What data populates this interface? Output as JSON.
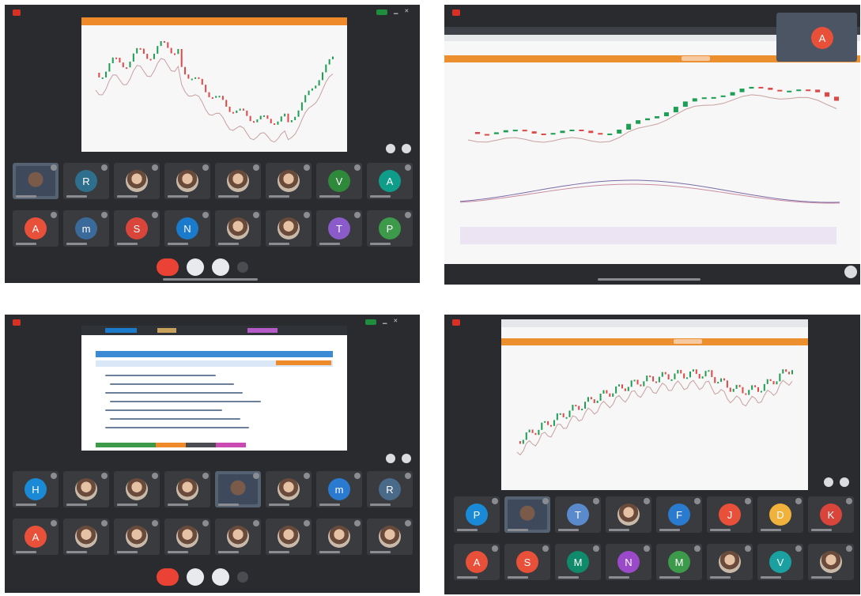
{
  "colors": {
    "panel_bg": "#2a2b2e",
    "tile_bg": "#3a3b3f",
    "accent_orange": "#ec8f2e",
    "up_candle": "#1e9e54",
    "down_candle": "#e04848",
    "record_red": "#d93025"
  },
  "panels": {
    "top_left": {
      "title": "",
      "tiles": [
        {
          "initial": "",
          "color": "",
          "kind": "camera"
        },
        {
          "initial": "R",
          "color": "#2f6f8e",
          "kind": "letter"
        },
        {
          "initial": "",
          "color": "",
          "kind": "photo"
        },
        {
          "initial": "",
          "color": "",
          "kind": "photo"
        },
        {
          "initial": "",
          "color": "",
          "kind": "photo"
        },
        {
          "initial": "",
          "color": "",
          "kind": "photo"
        },
        {
          "initial": "V",
          "color": "#2e8a3a",
          "kind": "letter"
        },
        {
          "initial": "A",
          "color": "#0f9d8a",
          "kind": "letter"
        },
        {
          "initial": "A",
          "color": "#e8503a",
          "kind": "letter"
        },
        {
          "initial": "m",
          "color": "#3a6a9a",
          "kind": "letter"
        },
        {
          "initial": "S",
          "color": "#d9453a",
          "kind": "letter"
        },
        {
          "initial": "N",
          "color": "#1a7acc",
          "kind": "letter"
        },
        {
          "initial": "",
          "color": "",
          "kind": "photo"
        },
        {
          "initial": "",
          "color": "",
          "kind": "photo"
        },
        {
          "initial": "T",
          "color": "#8a5bc9",
          "kind": "letter"
        },
        {
          "initial": "P",
          "color": "#3c9a4a",
          "kind": "letter"
        }
      ]
    },
    "top_right": {
      "presenter_initial": "A",
      "presenter_color": "#e8503a"
    },
    "bottom_left": {
      "tiles": [
        {
          "initial": "H",
          "color": "#1a8ad6",
          "kind": "letter"
        },
        {
          "initial": "",
          "color": "",
          "kind": "photo"
        },
        {
          "initial": "",
          "color": "",
          "kind": "photo"
        },
        {
          "initial": "",
          "color": "",
          "kind": "photo"
        },
        {
          "initial": "",
          "color": "",
          "kind": "camera"
        },
        {
          "initial": "",
          "color": "",
          "kind": "photo"
        },
        {
          "initial": "m",
          "color": "#2a7ad0",
          "kind": "letter"
        },
        {
          "initial": "R",
          "color": "#4a6a8a",
          "kind": "letter"
        },
        {
          "initial": "A",
          "color": "#e8503a",
          "kind": "letter"
        },
        {
          "initial": "",
          "color": "",
          "kind": "photo"
        },
        {
          "initial": "",
          "color": "",
          "kind": "photo"
        },
        {
          "initial": "",
          "color": "",
          "kind": "photo"
        },
        {
          "initial": "",
          "color": "",
          "kind": "photo"
        },
        {
          "initial": "",
          "color": "",
          "kind": "photo"
        },
        {
          "initial": "",
          "color": "",
          "kind": "photo"
        },
        {
          "initial": "",
          "color": "",
          "kind": "photo"
        }
      ]
    },
    "bottom_right": {
      "tiles": [
        {
          "initial": "P",
          "color": "#1a8ad6",
          "kind": "letter"
        },
        {
          "initial": "",
          "color": "",
          "kind": "camera"
        },
        {
          "initial": "T",
          "color": "#5a8acb",
          "kind": "letter"
        },
        {
          "initial": "",
          "color": "",
          "kind": "photo"
        },
        {
          "initial": "F",
          "color": "#2a7ad0",
          "kind": "letter"
        },
        {
          "initial": "J",
          "color": "#e8503a",
          "kind": "letter"
        },
        {
          "initial": "D",
          "color": "#f0b23a",
          "kind": "letter"
        },
        {
          "initial": "K",
          "color": "#d9453a",
          "kind": "letter"
        },
        {
          "initial": "A",
          "color": "#e8503a",
          "kind": "letter"
        },
        {
          "initial": "S",
          "color": "#e8503a",
          "kind": "letter"
        },
        {
          "initial": "M",
          "color": "#0f8a6a",
          "kind": "letter"
        },
        {
          "initial": "N",
          "color": "#9a4ac9",
          "kind": "letter"
        },
        {
          "initial": "M",
          "color": "#3c9a4a",
          "kind": "letter"
        },
        {
          "initial": "",
          "color": "",
          "kind": "photo"
        },
        {
          "initial": "V",
          "color": "#1aa0a0",
          "kind": "letter"
        },
        {
          "initial": "",
          "color": "",
          "kind": "photo"
        }
      ]
    }
  }
}
